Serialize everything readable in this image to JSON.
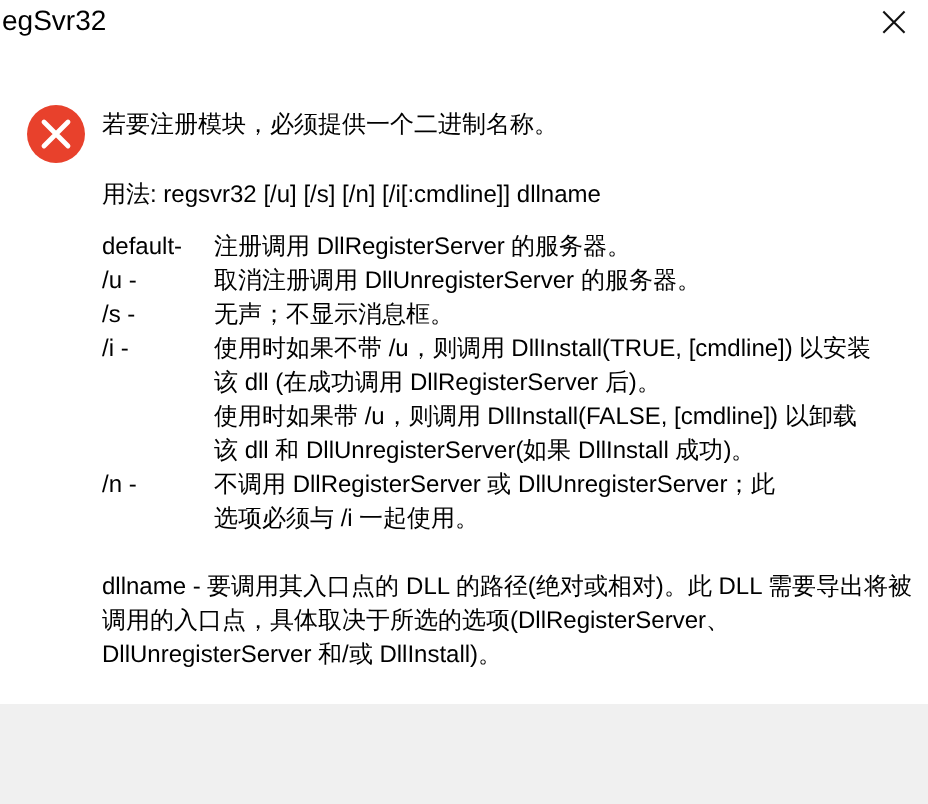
{
  "window": {
    "title": "egSvr32",
    "close": "×"
  },
  "message": "若要注册模块，必须提供一个二进制名称。",
  "usage": "用法: regsvr32 [/u] [/s] [/n] [/i[:cmdline]] dllname",
  "options": [
    {
      "flag": "default-",
      "lines": [
        "注册调用 DllRegisterServer 的服务器。"
      ]
    },
    {
      "flag": "/u -",
      "lines": [
        "取消注册调用 DllUnregisterServer 的服务器。"
      ]
    },
    {
      "flag": "/s -",
      "lines": [
        "无声；不显示消息框。"
      ]
    },
    {
      "flag": "/i -",
      "lines": [
        "使用时如果不带 /u，则调用 DllInstall(TRUE, [cmdline]) 以安装",
        "该 dll (在成功调用 DllRegisterServer 后)。",
        "使用时如果带 /u，则调用 DllInstall(FALSE, [cmdline]) 以卸载",
        "该 dll 和 DllUnregisterServer(如果 DllInstall 成功)。"
      ]
    },
    {
      "flag": "/n -",
      "lines": [
        "不调用 DllRegisterServer 或 DllUnregisterServer；此",
        "选项必须与 /i 一起使用。"
      ]
    }
  ],
  "description": [
    "dllname - 要调用其入口点的 DLL 的路径(绝对或相对)。此 DLL 需要导出将被",
    "调用的入口点，具体取决于所选的选项(DllRegisterServer、",
    "DllUnregisterServer 和/或 DllInstall)。"
  ]
}
